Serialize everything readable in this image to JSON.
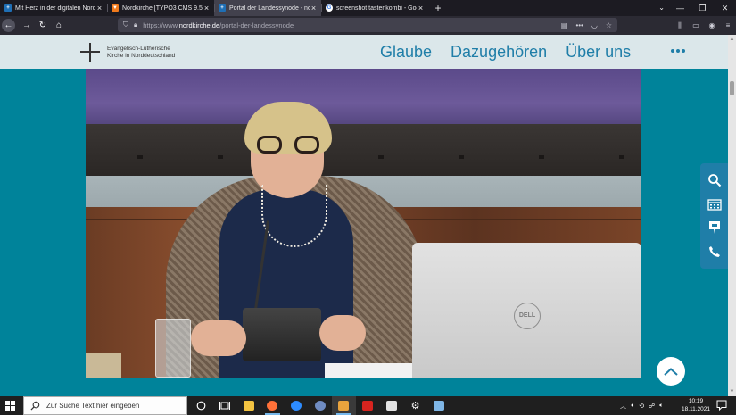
{
  "browser": {
    "tabs": [
      {
        "title": "Mit Herz in der digitalen Nordk",
        "favicon_color": "#1f6fb5",
        "active": false
      },
      {
        "title": "Nordkirche [TYPO3 CMS 9.5.20",
        "favicon_color": "#f07a1c",
        "active": false
      },
      {
        "title": "Portal der Landessynode - nor",
        "favicon_color": "#1f6fb5",
        "active": true
      },
      {
        "title": "screenshot tastenkombi - Goo",
        "favicon_color": "#ffffff",
        "active": false
      }
    ],
    "new_tab_label": "+",
    "url_prefix": "https://www.",
    "url_domain": "nordkirche.de",
    "url_path": "/portal-der-landessynode"
  },
  "site": {
    "logo_line1": "Evangelisch-Lutherische",
    "logo_line2": "Kirche in Norddeutschland",
    "nav": [
      "Glaube",
      "Dazugehören",
      "Über uns"
    ],
    "brand_color": "#1f7ea8",
    "background_color": "#00839a",
    "video_brand": "DELL"
  },
  "taskbar": {
    "search_placeholder": "Zur Suche Text hier eingeben",
    "time": "10:19",
    "date": "18.11.2021"
  }
}
